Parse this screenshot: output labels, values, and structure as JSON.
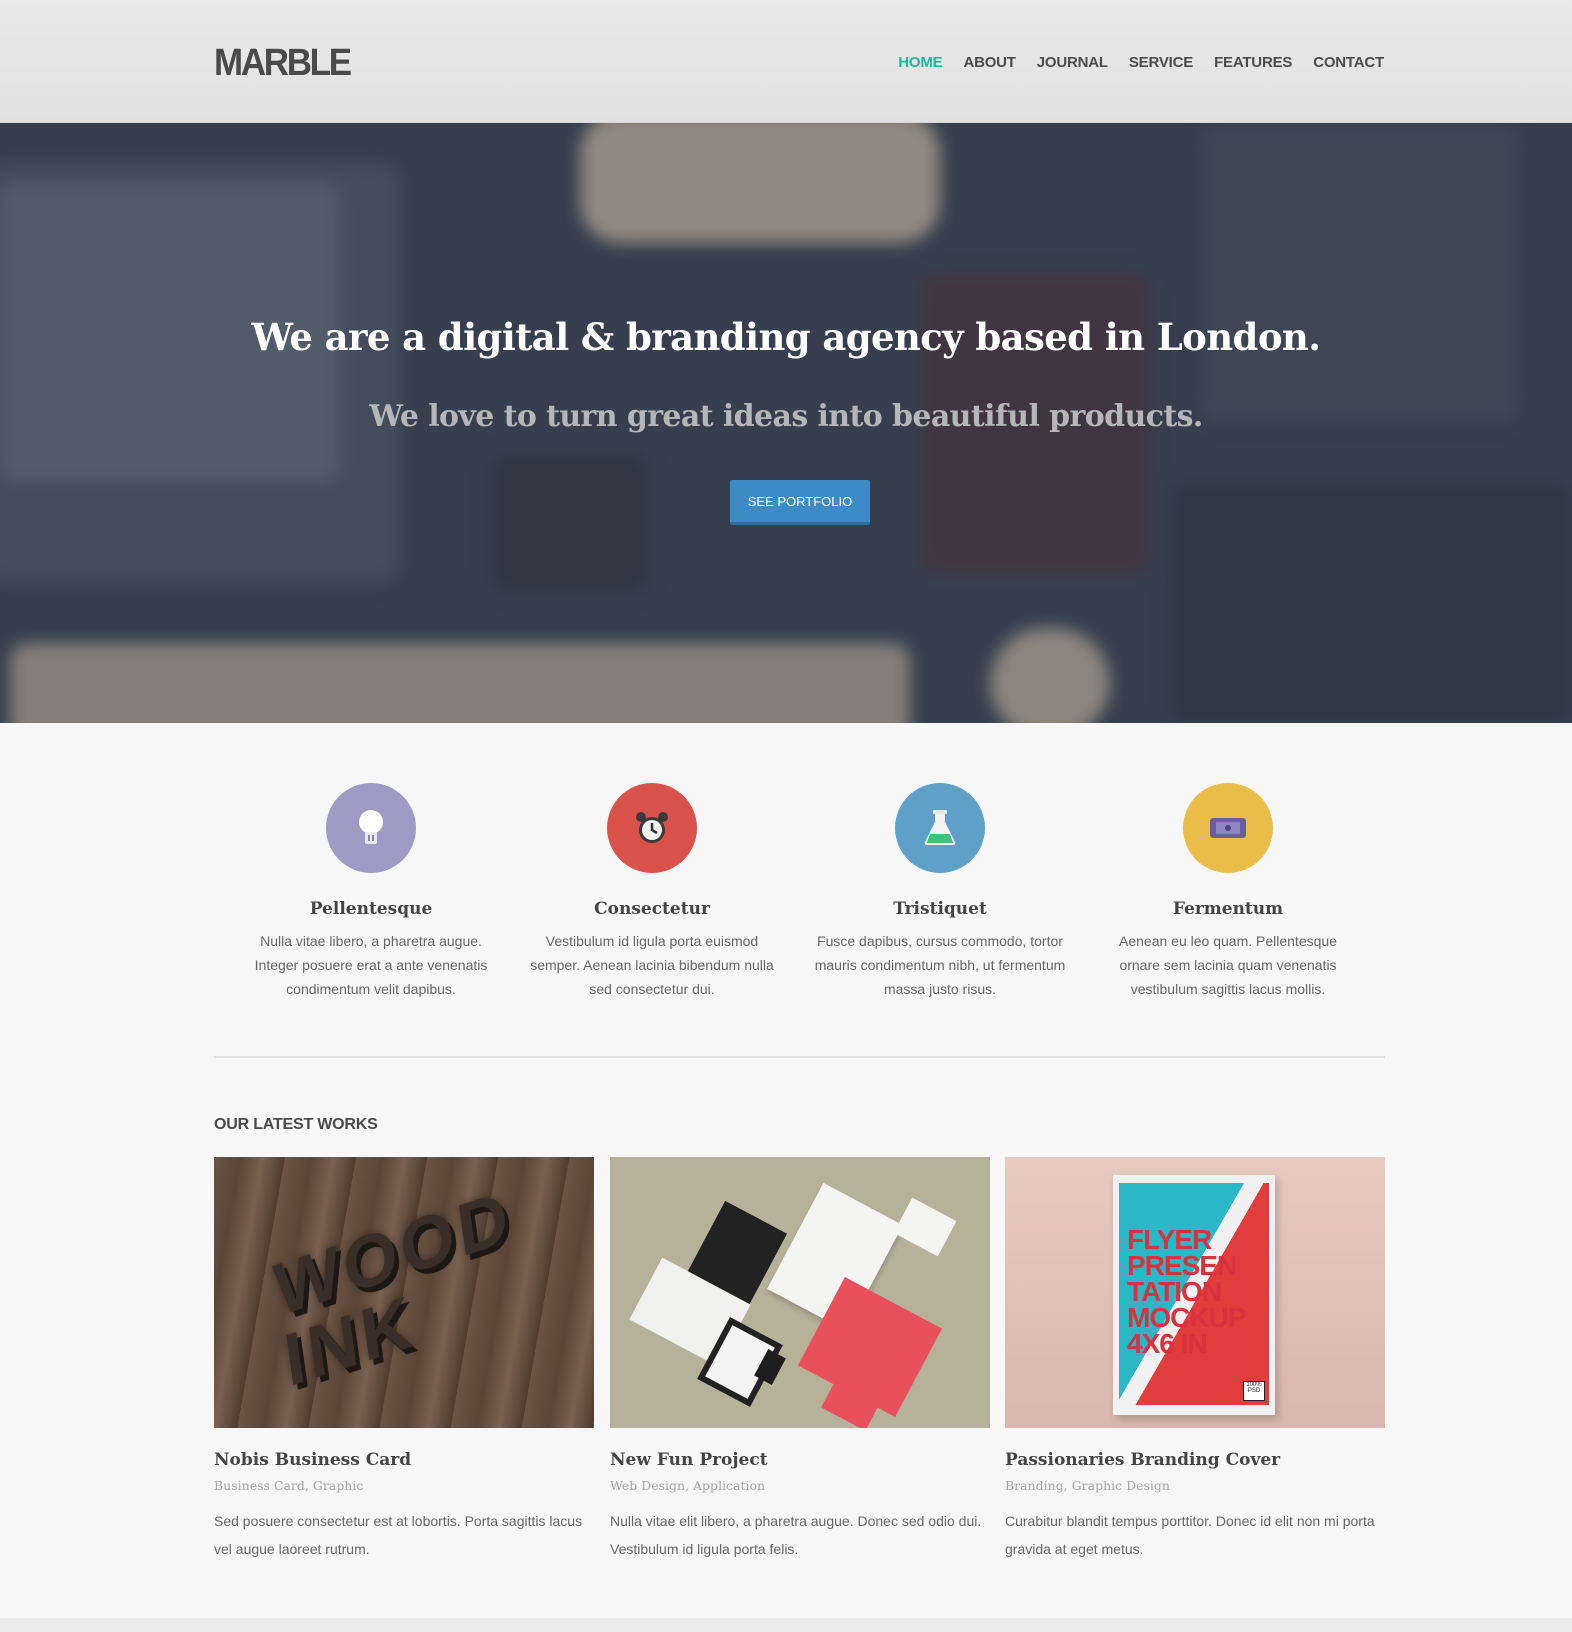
{
  "header": {
    "logo": "MARBLE",
    "nav": [
      "HOME",
      "ABOUT",
      "JOURNAL",
      "SERVICE",
      "FEATURES",
      "CONTACT"
    ],
    "active_nav": "HOME",
    "accent_color": "#1fb89a"
  },
  "hero": {
    "title": "We are a digital & branding agency based in London.",
    "subtitle": "We love to turn great ideas into beautiful products.",
    "button_label": "SEE PORTFOLIO"
  },
  "features": [
    {
      "icon": "lightbulb-icon",
      "color": "#9f9ac4",
      "title": "Pellentesque",
      "text": "Nulla vitae  libero, a pharetra augue. Integer posuere erat a ante venenatis condimentum velit dapibus."
    },
    {
      "icon": "alarm-clock-icon",
      "color": "#d9524c",
      "title": "Consectetur",
      "text": "Vestibulum id ligula porta  euismod semper. Aenean lacinia bibendum nulla sed consectetur dui."
    },
    {
      "icon": "flask-icon",
      "color": "#5fa0c9",
      "title": "Tristiquet",
      "text": "Fusce dapibus, cursus commodo, tortor mauris condimentum nibh, ut fermentum massa justo risus."
    },
    {
      "icon": "ticket-icon",
      "color": "#e9bd47",
      "title": "Fermentum",
      "text": "Aenean eu leo quam. Pellentesque ornare sem lacinia quam venenatis vestibulum sagittis lacus mollis."
    }
  ],
  "works": {
    "heading": "OUR LATEST WORKS",
    "items": [
      {
        "title": "Nobis Business Card",
        "category": "Business Card, Graphic",
        "description": "Sed posuere consectetur est at lobortis. Porta sagittis lacus vel augue laoreet rutrum.",
        "thumb_text": "WOOD INK"
      },
      {
        "title": "New Fun Project",
        "category": "Web Design, Application",
        "description": "Nulla vitae elit libero, a pharetra augue. Donec sed odio dui. Vestibulum id ligula porta felis.",
        "thumb_text": ""
      },
      {
        "title": "Passionaries Branding Cover",
        "category": "Branding, Graphic Design",
        "description": "Curabitur blandit tempus porttitor. Donec id elit non mi porta gravida at eget metus.",
        "thumb_text": "FLYER PRESEN TATION MOCKUP 4X6 IN",
        "badge": "100% PSD"
      }
    ]
  }
}
